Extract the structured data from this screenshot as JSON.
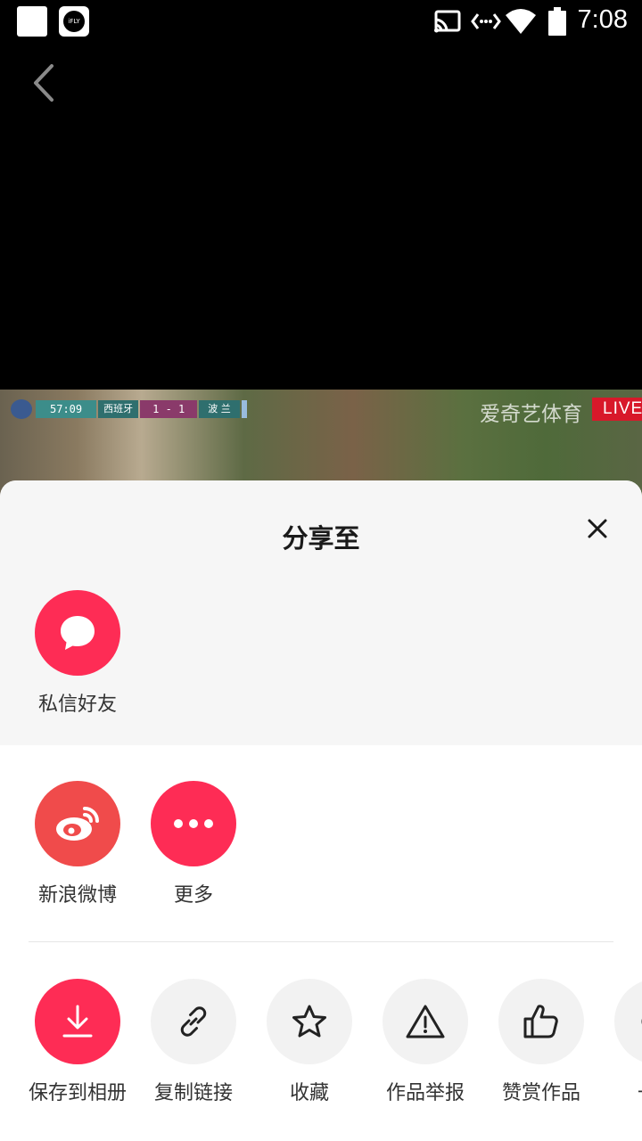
{
  "status_bar": {
    "time": "7:08",
    "ifly_label": "iFLY"
  },
  "video": {
    "clock": "57:09",
    "team_home": "西班牙",
    "score": "1 - 1",
    "team_away": "波 兰",
    "broadcaster": "爱奇艺体育",
    "live_badge": "LIVE"
  },
  "sheet": {
    "title": "分享至",
    "private_row": [
      {
        "label": "私信好友",
        "icon": "chat-bubble-icon"
      }
    ],
    "social_row": [
      {
        "label": "新浪微博",
        "icon": "weibo-icon"
      },
      {
        "label": "更多",
        "icon": "more-dots-icon"
      }
    ],
    "actions_row": [
      {
        "label": "保存到相册",
        "icon": "download-icon"
      },
      {
        "label": "复制链接",
        "icon": "link-icon"
      },
      {
        "label": "收藏",
        "icon": "star-icon"
      },
      {
        "label": "作品举报",
        "icon": "warning-icon"
      },
      {
        "label": "赞赏作品",
        "icon": "thumbs-up-icon"
      },
      {
        "label": "一起",
        "icon": "partial-icon"
      }
    ]
  },
  "colors": {
    "accent": "#fe2c55",
    "weibo": "#f04b4b",
    "sheet_top_bg": "#f6f6f6"
  }
}
